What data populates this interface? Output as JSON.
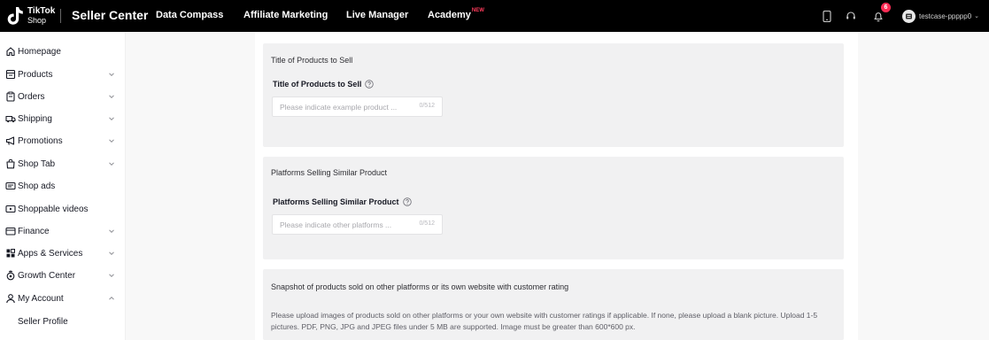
{
  "header": {
    "logo_line1": "TikTok",
    "logo_line2": "Shop",
    "brand": "Seller Center",
    "nav": [
      {
        "label": "Data Compass"
      },
      {
        "label": "Affiliate Marketing"
      },
      {
        "label": "Live Manager"
      },
      {
        "label": "Academy",
        "tag": "NEW"
      }
    ],
    "icons": [
      "mobile-icon",
      "headset-icon",
      "bell-icon"
    ],
    "notification_count": "6",
    "account_name": "testcase-ppppp0"
  },
  "sidebar": {
    "items": [
      {
        "label": "Homepage",
        "icon": "home-icon",
        "expandable": false
      },
      {
        "label": "Products",
        "icon": "products-icon",
        "expandable": true
      },
      {
        "label": "Orders",
        "icon": "orders-icon",
        "expandable": true
      },
      {
        "label": "Shipping",
        "icon": "truck-icon",
        "expandable": true
      },
      {
        "label": "Promotions",
        "icon": "megaphone-icon",
        "expandable": true
      },
      {
        "label": "Shop Tab",
        "icon": "shop-bag-icon",
        "expandable": true
      },
      {
        "label": "Shop ads",
        "icon": "ads-icon",
        "expandable": false
      },
      {
        "label": "Shoppable videos",
        "icon": "video-icon",
        "expandable": false
      },
      {
        "label": "Finance",
        "icon": "wallet-icon",
        "expandable": true
      },
      {
        "label": "Apps & Services",
        "icon": "apps-icon",
        "expandable": true
      },
      {
        "label": "Growth Center",
        "icon": "growth-icon",
        "expandable": true
      },
      {
        "label": "My Account",
        "icon": "user-icon",
        "expandable": true,
        "expanded": true
      }
    ],
    "sub_items": [
      {
        "label": "Seller Profile"
      }
    ]
  },
  "form": {
    "section1": {
      "title": "Title of Products to Sell",
      "field_label": "Title of Products to Sell",
      "placeholder": "Please indicate example product ...",
      "value": "",
      "counter": "0/512"
    },
    "section2": {
      "title": "Platforms Selling Similar Product",
      "field_label": "Platforms Selling Similar Product",
      "placeholder": "Please indicate other platforms ...",
      "value": "",
      "counter": "0/512"
    },
    "section3": {
      "title": "Snapshot of products sold on other platforms or its own website with customer rating",
      "description": "Please upload images of products sold on other platforms or your own website with customer ratings if applicable. If none, please upload a blank picture. Upload 1-5 pictures. PDF, PNG, JPG and JPEG files under 5 MB are supported. Image must be greater than 600*600 px."
    }
  },
  "colors": {
    "topbar": "#000000",
    "badge": "#fe2c55",
    "new_tag": "#ff3b5c",
    "section_bg": "#f1f1f2",
    "page_bg": "#f8f8f8"
  }
}
